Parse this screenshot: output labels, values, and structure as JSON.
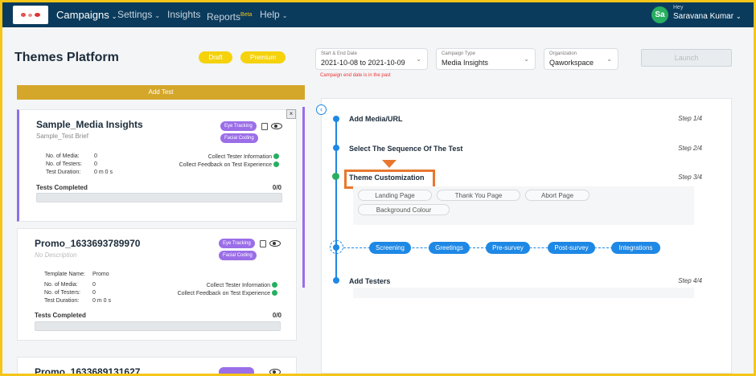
{
  "nav": {
    "items": [
      {
        "label": "Campaigns",
        "caret": "⌄"
      },
      {
        "label": "Settings",
        "caret": "⌄"
      },
      {
        "label": "Insights"
      },
      {
        "label": "Reports",
        "sup": "Beta"
      },
      {
        "label": "Help",
        "caret": "⌄"
      }
    ],
    "user": {
      "initials": "Sa",
      "greeting": "Hey",
      "name": "Saravana Kumar"
    }
  },
  "header": {
    "title": "Themes Platform",
    "badges": [
      "Draft",
      "Premium"
    ],
    "date_field": {
      "label": "Start & End Date",
      "value": "2021-10-08 to 2021-10-09"
    },
    "type_field": {
      "label": "Campaign Type",
      "value": "Media Insights"
    },
    "org_field": {
      "label": "Organization",
      "value": "Qaworkspace"
    },
    "error": "Campaign end date is in the past",
    "launch": "Launch"
  },
  "left": {
    "add_test": "Add Test",
    "close": "×",
    "cards": [
      {
        "name": "Sample_Media Insights",
        "desc": "Sample_Test Brief",
        "tags": [
          "Eye Tracking",
          "Facial Coding"
        ],
        "rows": [
          {
            "k": "No. of Media:",
            "v": "0"
          },
          {
            "k": "No. of Testers:",
            "v": "0"
          },
          {
            "k": "Test Duration:",
            "v": "0 m 0 s"
          }
        ],
        "collect": [
          "Collect Tester Information",
          "Collect Feedback on Test Experience"
        ],
        "completed_label": "Tests Completed",
        "completed_value": "0/0"
      },
      {
        "name": "Promo_1633693789970",
        "desc": "No Description",
        "tags": [
          "Eye Tracking",
          "Facial Coding"
        ],
        "template": {
          "k": "Template Name:",
          "v": "Promo"
        },
        "rows": [
          {
            "k": "No. of Media:",
            "v": "0"
          },
          {
            "k": "No. of Testers:",
            "v": "0"
          },
          {
            "k": "Test Duration:",
            "v": "0 m 0 s"
          }
        ],
        "collect": [
          "Collect Tester Information",
          "Collect Feedback on Test Experience"
        ],
        "completed_label": "Tests Completed",
        "completed_value": "0/0"
      },
      {
        "name": "Promo_1633689131627"
      }
    ]
  },
  "right": {
    "collapse": "‹",
    "steps": [
      {
        "label": "Add Media/URL",
        "num": "Step 1/4"
      },
      {
        "label": "Select The Sequence Of The Test",
        "num": "Step 2/4"
      },
      {
        "label": "Theme Customization",
        "num": "Step 3/4"
      },
      {
        "label": "Add Testers",
        "num": "Step 4/4"
      }
    ],
    "theme_options": [
      "Landing Page",
      "Thank You Page",
      "Abort Page",
      "Background Colour"
    ],
    "flow": [
      "Screening",
      "Greetings",
      "Pre-survey",
      "Post-survey",
      "Integrations"
    ]
  }
}
